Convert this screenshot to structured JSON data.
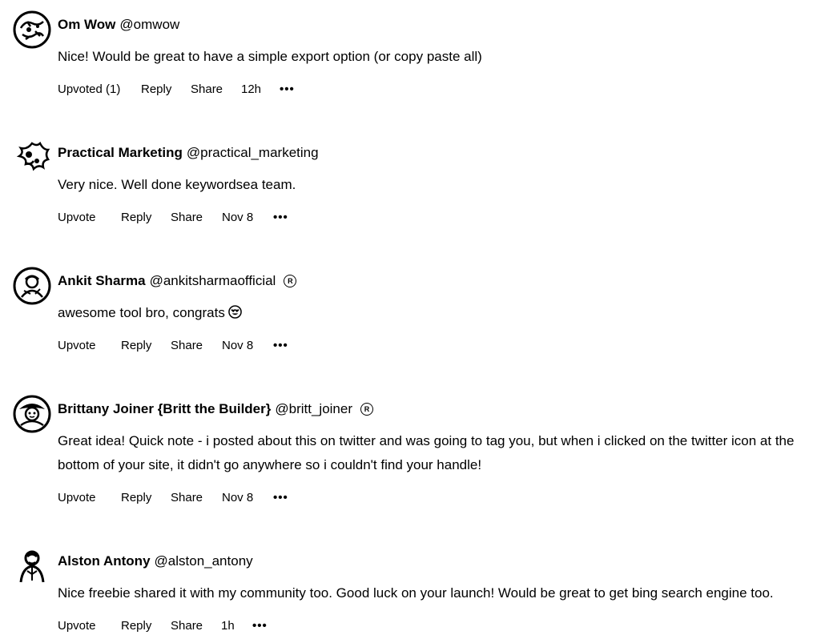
{
  "comments": [
    {
      "name": "Om Wow",
      "handle": "@omwow",
      "badge": "",
      "avatar_icon": "doodle-avatar-icon",
      "text": "Nice! Would be great to have a simple export option (or copy paste all)",
      "upvote_label": "Upvoted (1)",
      "reply_label": "Reply",
      "share_label": "Share",
      "time": "12h",
      "more_label": "•••"
    },
    {
      "name": "Practical Marketing",
      "handle": "@practical_marketing",
      "badge": "",
      "avatar_icon": "splash-avatar-icon",
      "text": "Very nice. Well done keywordsea team.",
      "upvote_label": "Upvote",
      "reply_label": "Reply",
      "share_label": "Share",
      "time": "Nov 8",
      "more_label": "•••"
    },
    {
      "name": "Ankit Sharma",
      "handle": "@ankitsharmaofficial",
      "badge": "R",
      "avatar_icon": "person-avatar-icon",
      "text": "awesome tool bro, congrats",
      "upvote_label": "Upvote",
      "reply_label": "Reply",
      "share_label": "Share",
      "time": "Nov 8",
      "more_label": "•••"
    },
    {
      "name": "Brittany Joiner {Britt the Builder}",
      "handle": "@britt_joiner",
      "badge": "R",
      "avatar_icon": "person-avatar-icon",
      "text": "Great idea! Quick note - i posted about this on twitter and was going to tag you, but when i clicked on the twitter icon at the bottom of your site, it didn't go anywhere so i couldn't find your handle!",
      "upvote_label": "Upvote",
      "reply_label": "Reply",
      "share_label": "Share",
      "time": "Nov 8",
      "more_label": "•••"
    },
    {
      "name": "Alston Antony",
      "handle": "@alston_antony",
      "badge": "",
      "avatar_icon": "person-avatar-icon",
      "text": "Nice freebie shared it with my community too. Good luck on your launch! Would be great to get bing search engine too.",
      "upvote_label": "Upvote",
      "reply_label": "Reply",
      "share_label": "Share",
      "time": "1h",
      "more_label": "•••"
    }
  ]
}
